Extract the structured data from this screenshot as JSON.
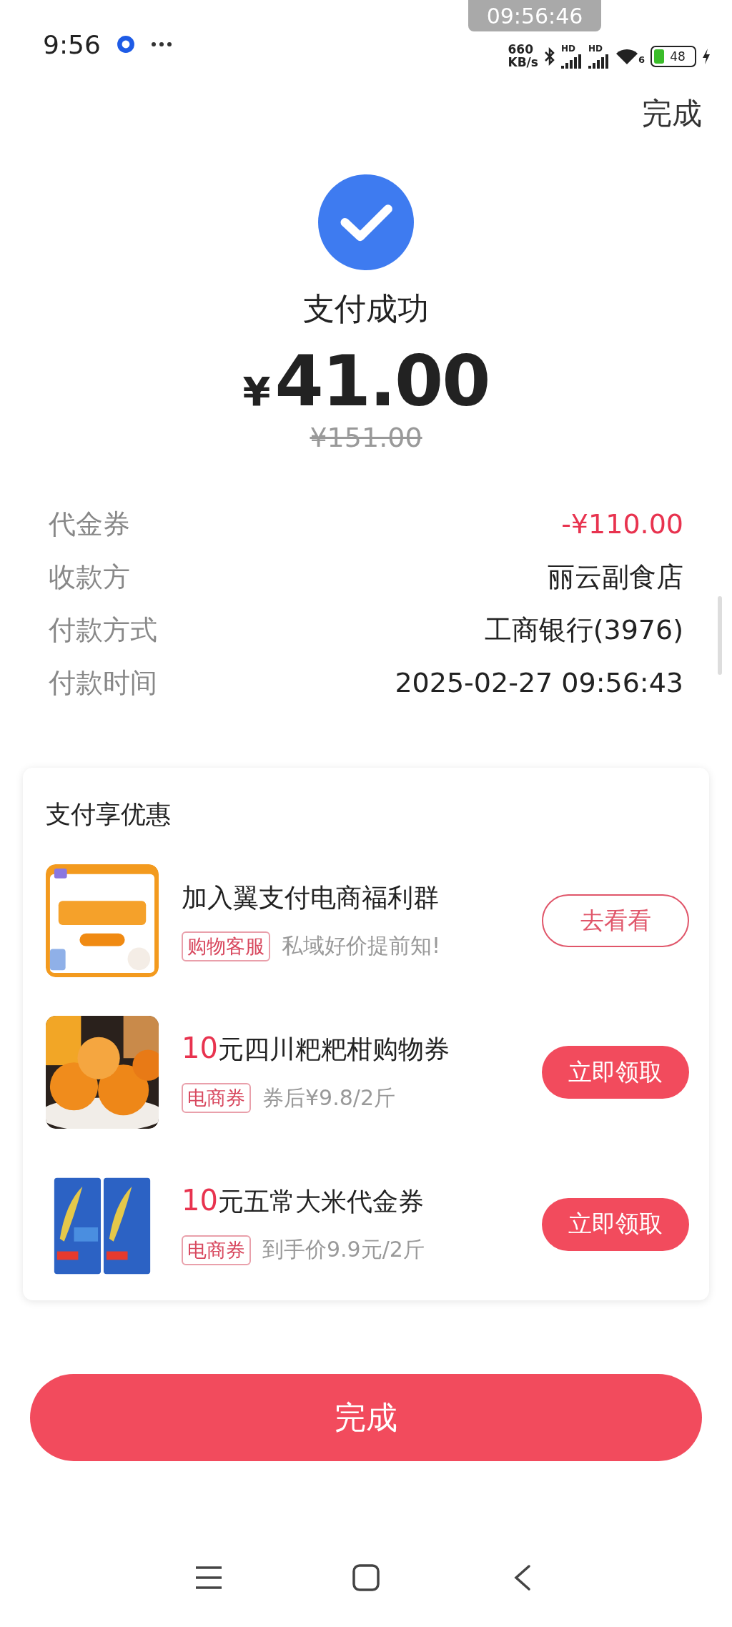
{
  "status_bar": {
    "time": "9:56",
    "speed": "660",
    "speed_unit": "KB/s",
    "sim_labels": [
      "HD",
      "HD"
    ],
    "wifi_label": "6",
    "battery": "48",
    "screenshot_time": "09:56:46"
  },
  "header": {
    "done": "完成"
  },
  "result": {
    "title": "支付成功",
    "currency": "¥",
    "amount": "41.00",
    "original": "¥151.00"
  },
  "details": [
    {
      "label": "代金券",
      "value": "-¥110.00",
      "kind": "discount"
    },
    {
      "label": "收款方",
      "value": "丽云副食店",
      "kind": "plain"
    },
    {
      "label": "付款方式",
      "value": "工商银行(3976)",
      "kind": "plain"
    },
    {
      "label": "付款时间",
      "value": "2025-02-27 09:56:43",
      "kind": "plain"
    }
  ],
  "offers": {
    "title": "支付享优惠",
    "items": [
      {
        "title": "加入翼支付电商福利群",
        "tag": "购物客服",
        "note": "私域好价提前知!",
        "button": "去看看",
        "kind": "outline"
      },
      {
        "amount": "10",
        "title": "元四川粑粑柑购物券",
        "tag": "电商券",
        "note": "券后¥9.8/2斤",
        "button": "立即领取",
        "kind": "filled"
      },
      {
        "amount": "10",
        "title": "元五常大米代金券",
        "tag": "电商券",
        "note": "到手价9.9元/2斤",
        "button": "立即领取",
        "kind": "filled"
      }
    ]
  },
  "done_button": "完成"
}
